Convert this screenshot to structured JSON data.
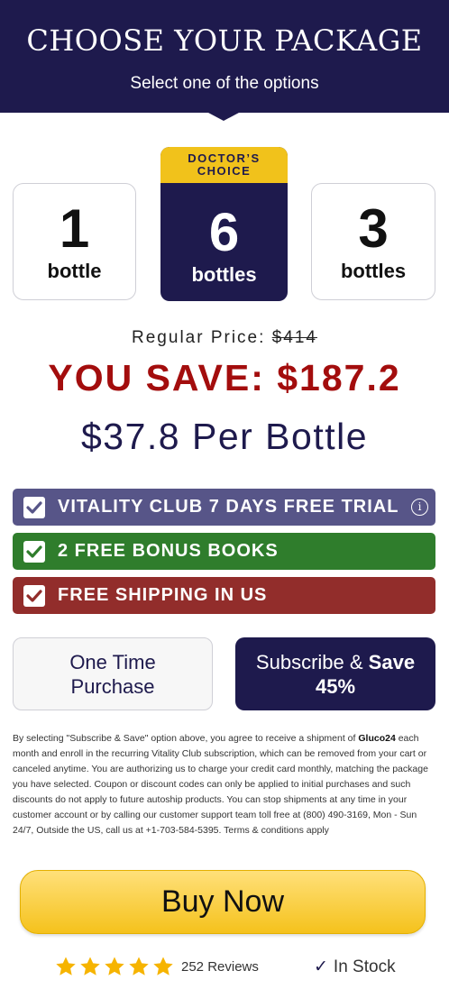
{
  "header": {
    "title": "CHOOSE YOUR PACKAGE",
    "subtitle": "Select one of the options"
  },
  "packages": [
    {
      "count": "1",
      "unit": "bottle",
      "selected": false
    },
    {
      "count": "6",
      "unit": "bottles",
      "selected": true,
      "badge": "DOCTOR'S CHOICE"
    },
    {
      "count": "3",
      "unit": "bottles",
      "selected": false
    }
  ],
  "pricing": {
    "regular_label": "Regular Price:",
    "regular_value": "$414",
    "save_text": "YOU SAVE: $187.2",
    "per_bottle": "$37.8 Per Bottle"
  },
  "perks": [
    {
      "label": "VITALITY CLUB 7 DAYS FREE TRIAL",
      "color": "#575588",
      "info_icon": "info-icon"
    },
    {
      "label": "2 FREE BONUS BOOKS",
      "color": "#2f7d2c"
    },
    {
      "label": "FREE SHIPPING IN US",
      "color": "#922d2b"
    }
  ],
  "purchase": {
    "one_time_line1": "One Time",
    "one_time_line2": "Purchase",
    "subscribe_pre": "Subscribe &",
    "subscribe_bold": "Save",
    "subscribe_pct": "45%"
  },
  "disclaimer": {
    "part1": "By selecting \"Subscribe & Save\" option above, you agree to receive a shipment of",
    "product": "Gluco24",
    "part2": "each month and enroll in the recurring Vitality Club subscription, which can be removed from your cart or canceled anytime. You are authorizing us to charge your credit card monthly, matching the package you have selected. Coupon or discount codes can only be applied to initial purchases and such discounts do not apply to future autoship products. You can stop shipments at any time in your customer account or by calling our customer support team toll free at (800) 490-3169, Mon - Sun 24/7, Outside the US, call us at +1-703-584-5395. Terms & conditions apply"
  },
  "buy_button": "Buy Now",
  "rating": {
    "stars": 5,
    "reviews": "252 Reviews",
    "star_color": "#f6b400"
  },
  "stock": {
    "check": "✓",
    "label": "In Stock"
  },
  "colors": {
    "navy": "#1e1a4d",
    "accent_yellow": "#f1c21b",
    "save_red": "#a30d0d"
  }
}
